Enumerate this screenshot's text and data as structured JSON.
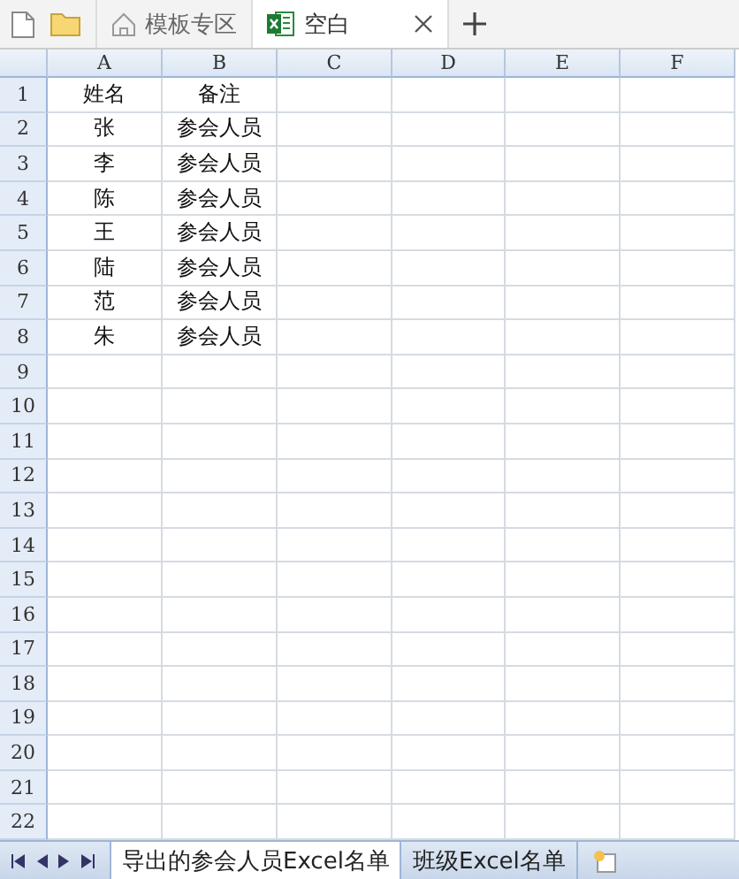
{
  "tabs": [
    {
      "label": "模板专区",
      "kind": "home",
      "selected": false
    },
    {
      "label": "空白",
      "kind": "sheet",
      "selected": true
    }
  ],
  "sheet": {
    "columns": [
      "A",
      "B",
      "C",
      "D",
      "E",
      "F"
    ],
    "rows": [
      {
        "number": "1",
        "cells": [
          "姓名",
          "备注"
        ]
      },
      {
        "number": "2",
        "cells": [
          "张",
          "参会人员"
        ]
      },
      {
        "number": "3",
        "cells": [
          "李",
          "参会人员"
        ]
      },
      {
        "number": "4",
        "cells": [
          "陈",
          "参会人员"
        ]
      },
      {
        "number": "5",
        "cells": [
          "王",
          "参会人员"
        ]
      },
      {
        "number": "6",
        "cells": [
          "陆",
          "参会人员"
        ]
      },
      {
        "number": "7",
        "cells": [
          "范",
          "参会人员"
        ]
      },
      {
        "number": "8",
        "cells": [
          "朱",
          "参会人员"
        ]
      },
      {
        "number": "9",
        "cells": []
      },
      {
        "number": "10",
        "cells": []
      },
      {
        "number": "11",
        "cells": []
      },
      {
        "number": "12",
        "cells": []
      },
      {
        "number": "13",
        "cells": []
      },
      {
        "number": "14",
        "cells": []
      },
      {
        "number": "15",
        "cells": []
      },
      {
        "number": "16",
        "cells": []
      },
      {
        "number": "17",
        "cells": []
      },
      {
        "number": "18",
        "cells": []
      },
      {
        "number": "19",
        "cells": []
      },
      {
        "number": "20",
        "cells": []
      },
      {
        "number": "21",
        "cells": []
      },
      {
        "number": "22",
        "cells": []
      }
    ]
  },
  "sheet_tabs": [
    {
      "label": "导出的参会人员Excel名单",
      "selected": true
    },
    {
      "label": "班级Excel名单",
      "selected": false
    }
  ]
}
